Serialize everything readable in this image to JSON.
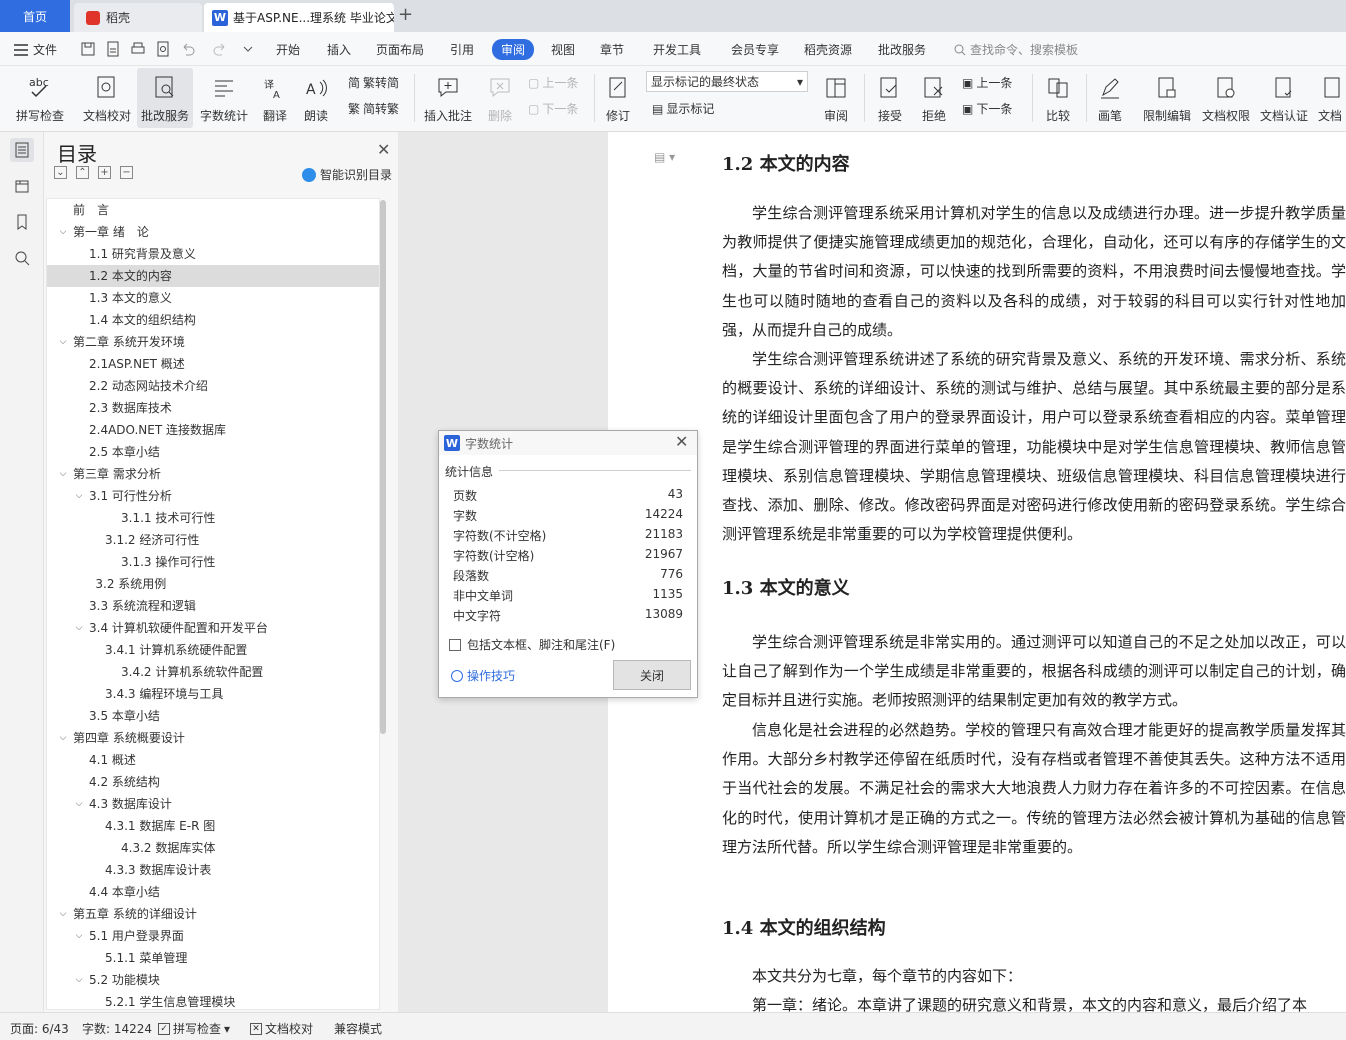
{
  "tabs": {
    "home": "首页",
    "daoke": "稻壳",
    "doc": "基于ASP.NE...理系统 毕业论文"
  },
  "menu": {
    "file": "文件",
    "items": [
      "开始",
      "插入",
      "页面布局",
      "引用",
      "审阅",
      "视图",
      "章节",
      "开发工具",
      "会员专享",
      "稻壳资源",
      "批改服务"
    ],
    "active_index": 4,
    "search": "查找命令、搜索模板"
  },
  "ribbon": {
    "spellcheck": "拼写检查",
    "doc_proof": "文档校对",
    "grading": "批改服务",
    "word_count": "字数统计",
    "translate": "翻译",
    "read_aloud": "朗读",
    "trad": "繁转简",
    "simp": "简转繁",
    "insert_comment": "插入批注",
    "delete": "删除",
    "prev_comment": "上一条",
    "next_comment": "下一条",
    "revise": "修订",
    "markup_select": "显示标记的最终状态",
    "show_markup": "显示标记",
    "review": "审阅",
    "accept": "接受",
    "reject": "拒绝",
    "prev_change": "上一条",
    "next_change": "下一条",
    "compare": "比较",
    "pen": "画笔",
    "restrict_edit": "限制编辑",
    "doc_perm": "文档权限",
    "doc_cert": "文档认证",
    "doc_more": "文档"
  },
  "toc": {
    "title": "目录",
    "smart": "智能识别目录",
    "items": [
      {
        "label": "前　言",
        "level": 0,
        "arrow": ""
      },
      {
        "label": "第一章 绪　论",
        "level": 0,
        "arrow": "v"
      },
      {
        "label": "1.1 研究背景及意义",
        "level": 1,
        "arrow": ""
      },
      {
        "label": "1.2 本文的内容",
        "level": 1,
        "arrow": "",
        "selected": true
      },
      {
        "label": "1.3 本文的意义",
        "level": 1,
        "arrow": ""
      },
      {
        "label": "1.4 本文的组织结构",
        "level": 1,
        "arrow": ""
      },
      {
        "label": "第二章 系统开发环境",
        "level": 0,
        "arrow": "v"
      },
      {
        "label": "2.1ASP.NET 概述",
        "level": 1,
        "arrow": ""
      },
      {
        "label": "2.2 动态网站技术介绍",
        "level": 1,
        "arrow": ""
      },
      {
        "label": "2.3 数据库技术",
        "level": 1,
        "arrow": ""
      },
      {
        "label": "2.4ADO.NET 连接数据库",
        "level": 1,
        "arrow": ""
      },
      {
        "label": "2.5 本章小结",
        "level": 1,
        "arrow": ""
      },
      {
        "label": "第三章 需求分析",
        "level": 0,
        "arrow": "v"
      },
      {
        "label": "3.1 可行性分析",
        "level": 1,
        "arrow": "v"
      },
      {
        "label": "3.1.1 技术可行性",
        "level": 3,
        "arrow": ""
      },
      {
        "label": "3.1.2 经济可行性",
        "level": 2,
        "arrow": ""
      },
      {
        "label": "3.1.3 操作可行性",
        "level": 3,
        "arrow": ""
      },
      {
        "label": "3.2 系统用例",
        "level": 1.4,
        "arrow": ""
      },
      {
        "label": "3.3 系统流程和逻辑",
        "level": 1,
        "arrow": ""
      },
      {
        "label": "3.4 计算机软硬件配置和开发平台",
        "level": 1,
        "arrow": "v"
      },
      {
        "label": "3.4.1 计算机系统硬件配置",
        "level": 2,
        "arrow": ""
      },
      {
        "label": "3.4.2 计算机系统软件配置",
        "level": 3,
        "arrow": ""
      },
      {
        "label": "3.4.3 编程环境与工具",
        "level": 2,
        "arrow": ""
      },
      {
        "label": "3.5 本章小结",
        "level": 1,
        "arrow": ""
      },
      {
        "label": "第四章 系统概要设计",
        "level": 0,
        "arrow": "v"
      },
      {
        "label": "4.1 概述",
        "level": 1,
        "arrow": ""
      },
      {
        "label": "4.2 系统结构",
        "level": 1,
        "arrow": ""
      },
      {
        "label": "4.3 数据库设计",
        "level": 1,
        "arrow": "v"
      },
      {
        "label": "4.3.1 数据库 E-R 图",
        "level": 2,
        "arrow": ""
      },
      {
        "label": "4.3.2 数据库实体",
        "level": 3,
        "arrow": ""
      },
      {
        "label": "4.3.3 数据库设计表",
        "level": 2,
        "arrow": ""
      },
      {
        "label": "4.4 本章小结",
        "level": 1,
        "arrow": ""
      },
      {
        "label": "第五章 系统的详细设计",
        "level": 0,
        "arrow": "v"
      },
      {
        "label": "5.1 用户登录界面",
        "level": 1,
        "arrow": "v"
      },
      {
        "label": "5.1.1 菜单管理",
        "level": 2,
        "arrow": ""
      },
      {
        "label": "5.2 功能模块",
        "level": 1,
        "arrow": "v"
      },
      {
        "label": "5.2.1 学生信息管理模块",
        "level": 2,
        "arrow": ""
      }
    ]
  },
  "doc": {
    "h12": "1.2 本文的内容",
    "p1": "学生综合测评管理系统采用计算机对学生的信息以及成绩进行办理。进一步提升教学质量为教师提供了便捷实施管理成绩更加的规范化，合理化，自动化，还可以有序的存储学生的文档，大量的节省时间和资源，可以快速的找到所需要的资料，不用浪费时间去慢慢地查找。学生也可以随时随地的查看自己的资料以及各科的成绩，对于较弱的科目可以实行针对性地加强，从而提升自己的成绩。",
    "p2": "学生综合测评管理系统讲述了系统的研究背景及意义、系统的开发环境、需求分析、系统的概要设计、系统的详细设计、系统的测试与维护、总结与展望。其中系统最主要的部分是系统的详细设计里面包含了用户的登录界面设计，用户可以登录系统查看相应的内容。菜单管理是学生综合测评管理的界面进行菜单的管理，功能模块中是对学生信息管理模块、教师信息管理模块、系别信息管理模块、学期信息管理模块、班级信息管理模块、科目信息管理模块进行查找、添加、删除、修改。修改密码界面是对密码进行修改使用新的密码登录系统。学生综合测评管理系统是非常重要的可以为学校管理提供便利。",
    "h13": "1.3 本文的意义",
    "p3": "学生综合测评管理系统是非常实用的。通过测评可以知道自己的不足之处加以改正，可以让自己了解到作为一个学生成绩是非常重要的，根据各科成绩的测评可以制定自己的计划，确定目标并且进行实施。老师按照测评的结果制定更加有效的教学方式。",
    "p4": "信息化是社会进程的必然趋势。学校的管理只有高效合理才能更好的提高教学质量发挥其作用。大部分乡村教学还停留在纸质时代，没有存档或者管理不善使其丢失。这种方法不适用于当代社会的发展。不满足社会的需求大大地浪费人力财力存在着许多的不可控因素。在信息化的时代，使用计算机才是正确的方式之一。传统的管理方法必然会被计算机为基础的信息管理方法所代替。所以学生综合测评管理是非常重要的。",
    "h14": "1.4 本文的组织结构",
    "p5": "本文共分为七章，每个章节的内容如下：",
    "p6": "第一章：绪论。本章讲了课题的研究意义和背景，本文的内容和意义，最后介绍了本"
  },
  "dialog": {
    "title": "字数统计",
    "section": "统计信息",
    "rows": [
      {
        "label": "页数",
        "value": "43"
      },
      {
        "label": "字数",
        "value": "14224"
      },
      {
        "label": "字符数(不计空格)",
        "value": "21183"
      },
      {
        "label": "字符数(计空格)",
        "value": "21967"
      },
      {
        "label": "段落数",
        "value": "776"
      },
      {
        "label": "非中文单词",
        "value": "1135"
      },
      {
        "label": "中文字符",
        "value": "13089"
      }
    ],
    "include": "包括文本框、脚注和尾注(F)",
    "tips": "操作技巧",
    "close": "关闭"
  },
  "status": {
    "page": "页面: 6/43",
    "words": "字数: 14224",
    "spell": "拼写检查",
    "proof": "文档校对",
    "compat": "兼容模式"
  },
  "colors": {
    "accent": "#2f6de1",
    "tab_bg": "#dcdfe4"
  }
}
